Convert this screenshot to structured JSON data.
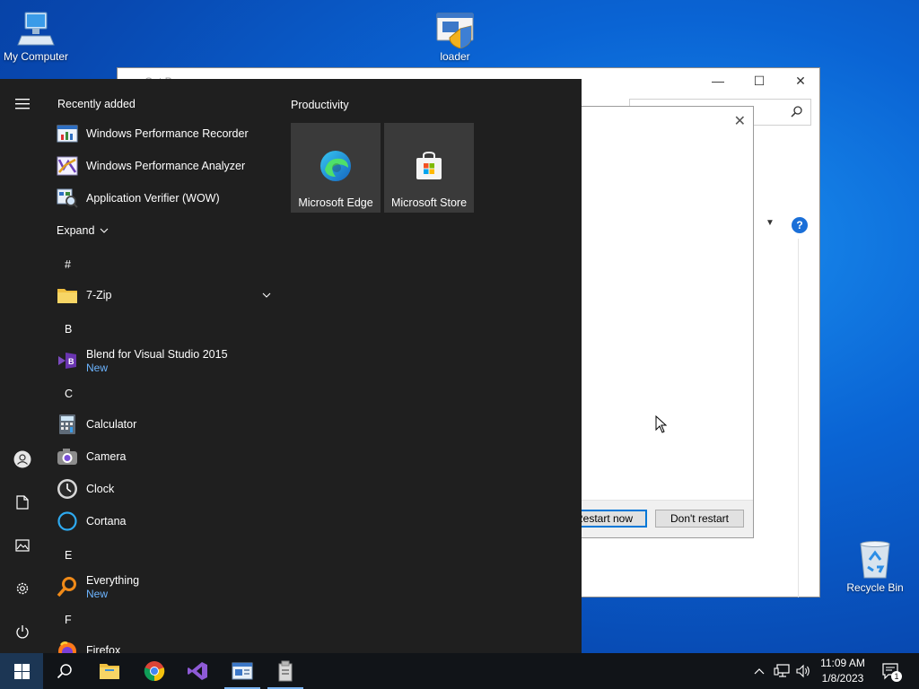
{
  "desktop": {
    "icons": [
      {
        "label": "My Computer"
      },
      {
        "label": "loader"
      },
      {
        "label": "Recycle Bin"
      }
    ]
  },
  "background_window": {
    "title": "Get P",
    "controls": {
      "minimize": "—",
      "maximize": "☐",
      "close": "✕"
    }
  },
  "dialog": {
    "close": "✕",
    "buttons": {
      "restart_now": "Restart now",
      "dont_restart": "Don't restart"
    }
  },
  "start_menu": {
    "recently_added_header": "Recently added",
    "recently_added": [
      {
        "label": "Windows Performance Recorder"
      },
      {
        "label": "Windows Performance Analyzer"
      },
      {
        "label": "Application Verifier (WOW)"
      }
    ],
    "expand_label": "Expand",
    "groups": [
      {
        "letter": "#",
        "apps": [
          {
            "label": "7-Zip",
            "sub": ""
          }
        ]
      },
      {
        "letter": "B",
        "apps": [
          {
            "label": "Blend for Visual Studio 2015",
            "sub": "New"
          }
        ]
      },
      {
        "letter": "C",
        "apps": [
          {
            "label": "Calculator",
            "sub": ""
          },
          {
            "label": "Camera",
            "sub": ""
          },
          {
            "label": "Clock",
            "sub": ""
          },
          {
            "label": "Cortana",
            "sub": ""
          }
        ]
      },
      {
        "letter": "E",
        "apps": [
          {
            "label": "Everything",
            "sub": "New"
          }
        ]
      },
      {
        "letter": "F",
        "apps": [
          {
            "label": "Firefox",
            "sub": ""
          }
        ]
      }
    ],
    "tiles_header": "Productivity",
    "tiles": [
      {
        "label": "Microsoft Edge"
      },
      {
        "label": "Microsoft Store"
      }
    ]
  },
  "taskbar": {
    "clock_time": "11:09 AM",
    "clock_date": "1/8/2023",
    "notification_count": "1"
  },
  "colors": {
    "accent": "#0078d7",
    "start_bg": "#1f1f1f",
    "taskbar_bg": "#111418",
    "new_badge": "#6cb4ff"
  }
}
